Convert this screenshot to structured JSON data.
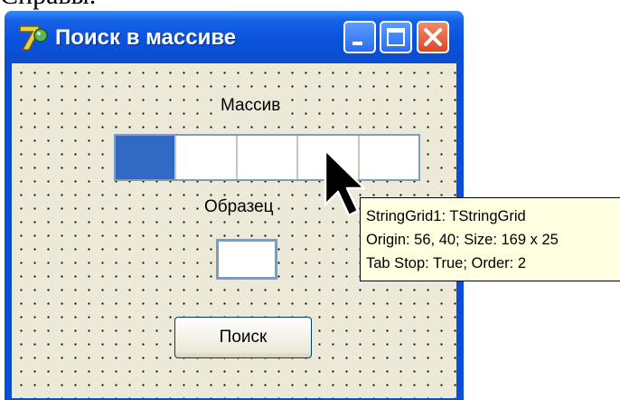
{
  "page_top_text": "Справы.",
  "window": {
    "title": "Поиск в массиве",
    "app_icon": "delphi-7-icon",
    "controls": {
      "minimize_icon": "minimize-icon",
      "maximize_icon": "maximize-icon",
      "close_icon": "close-icon"
    }
  },
  "form": {
    "array_label": "Массив",
    "sample_label": "Образец",
    "search_button_label": "Поиск",
    "sample_value": "",
    "grid": {
      "columns": 5,
      "selected_column": 0
    }
  },
  "tooltip": {
    "line1": "StringGrid1: TStringGrid",
    "line2": "Origin: 56, 40; Size: 169 x 25",
    "line3": "Tab Stop: True; Order: 2"
  },
  "colors": {
    "title_bar": "#0a52dc",
    "form_background": "#ece9d8",
    "grid_selection": "#316ac5",
    "close_button": "#d9482a",
    "tooltip_background": "#ffffe1"
  }
}
